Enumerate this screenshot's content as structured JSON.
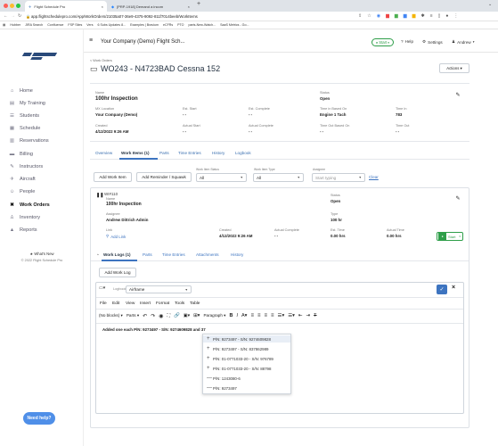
{
  "browser": {
    "tabs": [
      {
        "label": "Flight Schedule Pro"
      },
      {
        "label": "[PRP-1918] Demand a incom"
      }
    ],
    "new_tab": "+",
    "url": "app.flightschedulepro.com/App/WorkOrders/21035a07-36e9-4375-9092-811f7014beeb/WorkItems",
    "bookmarks": [
      "Hubber",
      "JIRA Search",
      "Confluence",
      "FSP Sites",
      "Vers",
      "6 Subs Updates 8...",
      "Examples | Bravium",
      "eCFRs",
      "PTO",
      "parts-New-Watch...",
      "SaaS Metrics - Go..."
    ]
  },
  "sidebar": {
    "items": [
      {
        "label": "Home",
        "icon": "home-icon",
        "glyph": "⌂"
      },
      {
        "label": "My Training",
        "icon": "training-icon",
        "glyph": "▤"
      },
      {
        "label": "Students",
        "icon": "students-icon",
        "glyph": "☰"
      },
      {
        "label": "Schedule",
        "icon": "calendar-icon",
        "glyph": "▦"
      },
      {
        "label": "Reservations",
        "icon": "reservations-icon",
        "glyph": "▥"
      },
      {
        "label": "Billing",
        "icon": "billing-icon",
        "glyph": "▬"
      },
      {
        "label": "Instructors",
        "icon": "instructors-icon",
        "glyph": "✎"
      },
      {
        "label": "Aircraft",
        "icon": "aircraft-icon",
        "glyph": "✈"
      },
      {
        "label": "People",
        "icon": "people-icon",
        "glyph": "☺"
      },
      {
        "label": "Work Orders",
        "icon": "wrench-icon",
        "glyph": "✖"
      },
      {
        "label": "Inventory",
        "icon": "inventory-icon",
        "glyph": "♙"
      },
      {
        "label": "Reports",
        "icon": "reports-icon",
        "glyph": "▲"
      }
    ],
    "active": "Work Orders",
    "whats_new": "★ What's New",
    "copyright": "© 2022 Flight Schedule Pro",
    "need_help": "Need help?"
  },
  "topbar": {
    "company": "Your Company (Demo) Flight Sch...",
    "start_label": "Start",
    "help_label": "Help",
    "settings_label": "Settings",
    "user_label": "Andrew"
  },
  "header": {
    "breadcrumb": "< Work Orders",
    "title": "WO243 - N4723BAD Cessna 152",
    "actions_label": "Actions ▾"
  },
  "summary": {
    "name_label": "Name",
    "name": "100hr Inspection",
    "status_label": "Status",
    "status": "Open",
    "fields_row1": [
      {
        "label": "MX Location",
        "value": "Your Company (Demo)"
      },
      {
        "label": "Est. Start",
        "value": "- -"
      },
      {
        "label": "Est. Complete",
        "value": "- -"
      },
      {
        "label": "Time in Based On",
        "value": "Engine 1 Tach"
      },
      {
        "label": "Time In",
        "value": "783"
      }
    ],
    "fields_row2": [
      {
        "label": "Created",
        "value": "4/12/2022 9:26 AM"
      },
      {
        "label": "Actual Start",
        "value": "- -"
      },
      {
        "label": "Actual Complete",
        "value": "- -"
      },
      {
        "label": "Time Out Based On",
        "value": "- -"
      },
      {
        "label": "Time Out",
        "value": "- -"
      }
    ]
  },
  "tabs": [
    "Overview",
    "Work Items (1)",
    "Parts",
    "Time Entries",
    "History",
    "Logbook"
  ],
  "filters": {
    "add_work_item": "Add Work Item",
    "add_reminder": "Add Reminder / Squawk",
    "status_label": "Work Item Status",
    "status_value": "All",
    "type_label": "Work Item Type",
    "type_value": "All",
    "assignee_label": "Assignee",
    "assignee_value": "Start typing",
    "clear": "Clear"
  },
  "work_item": {
    "number": "WI#110",
    "name_label": "Name",
    "name": "100hr Inspection",
    "status_label": "Status",
    "status": "Open",
    "assignee_label": "Assignee",
    "assignee": "Andrew Dittrich Admin",
    "type_label": "Type",
    "type": "100 hr",
    "link_label": "Link",
    "add_link": "Add Link",
    "created_label": "Created",
    "created": "4/12/2022 9:26 AM",
    "actual_complete_label": "Actual Complete",
    "actual_complete": "- -",
    "est_time_label": "Est. Time",
    "est_time": "0.00 hrs",
    "actual_time_label": "Actual Time",
    "actual_time": "0.00 hrs",
    "start_btn": "Start",
    "sub_tabs": [
      "Work Logs (1)",
      "Parts",
      "Time Entries",
      "Attachments",
      "History"
    ],
    "add_work_log": "Add Work Log"
  },
  "editor": {
    "logbook_label": "Logbook",
    "logbook_value": "Airframe",
    "menu": [
      "File",
      "Edit",
      "View",
      "Insert",
      "Format",
      "Tools",
      "Table"
    ],
    "block_value": "(No blocks)",
    "parts_label": "Parts",
    "paragraph_value": "Paragraph",
    "content": "Added one each P/N: 9273497 - S/N: 9274609828 and 37",
    "suggestions": [
      "P/N: 9273497 - S/N: 9274609828",
      "P/N: 9273497 - S/N: 837862989",
      "P/N: 01-0771033-20 - S/N: 976789",
      "P/N: 01-0771033-20 - S/N: 88798",
      "P/N: 1243080-6",
      "P/N: 9273497"
    ]
  },
  "colors": {
    "accent": "#3d74c0",
    "logo": "#2a4a7a",
    "help": "#4f8fe8",
    "start_green": "#2e9e49"
  }
}
